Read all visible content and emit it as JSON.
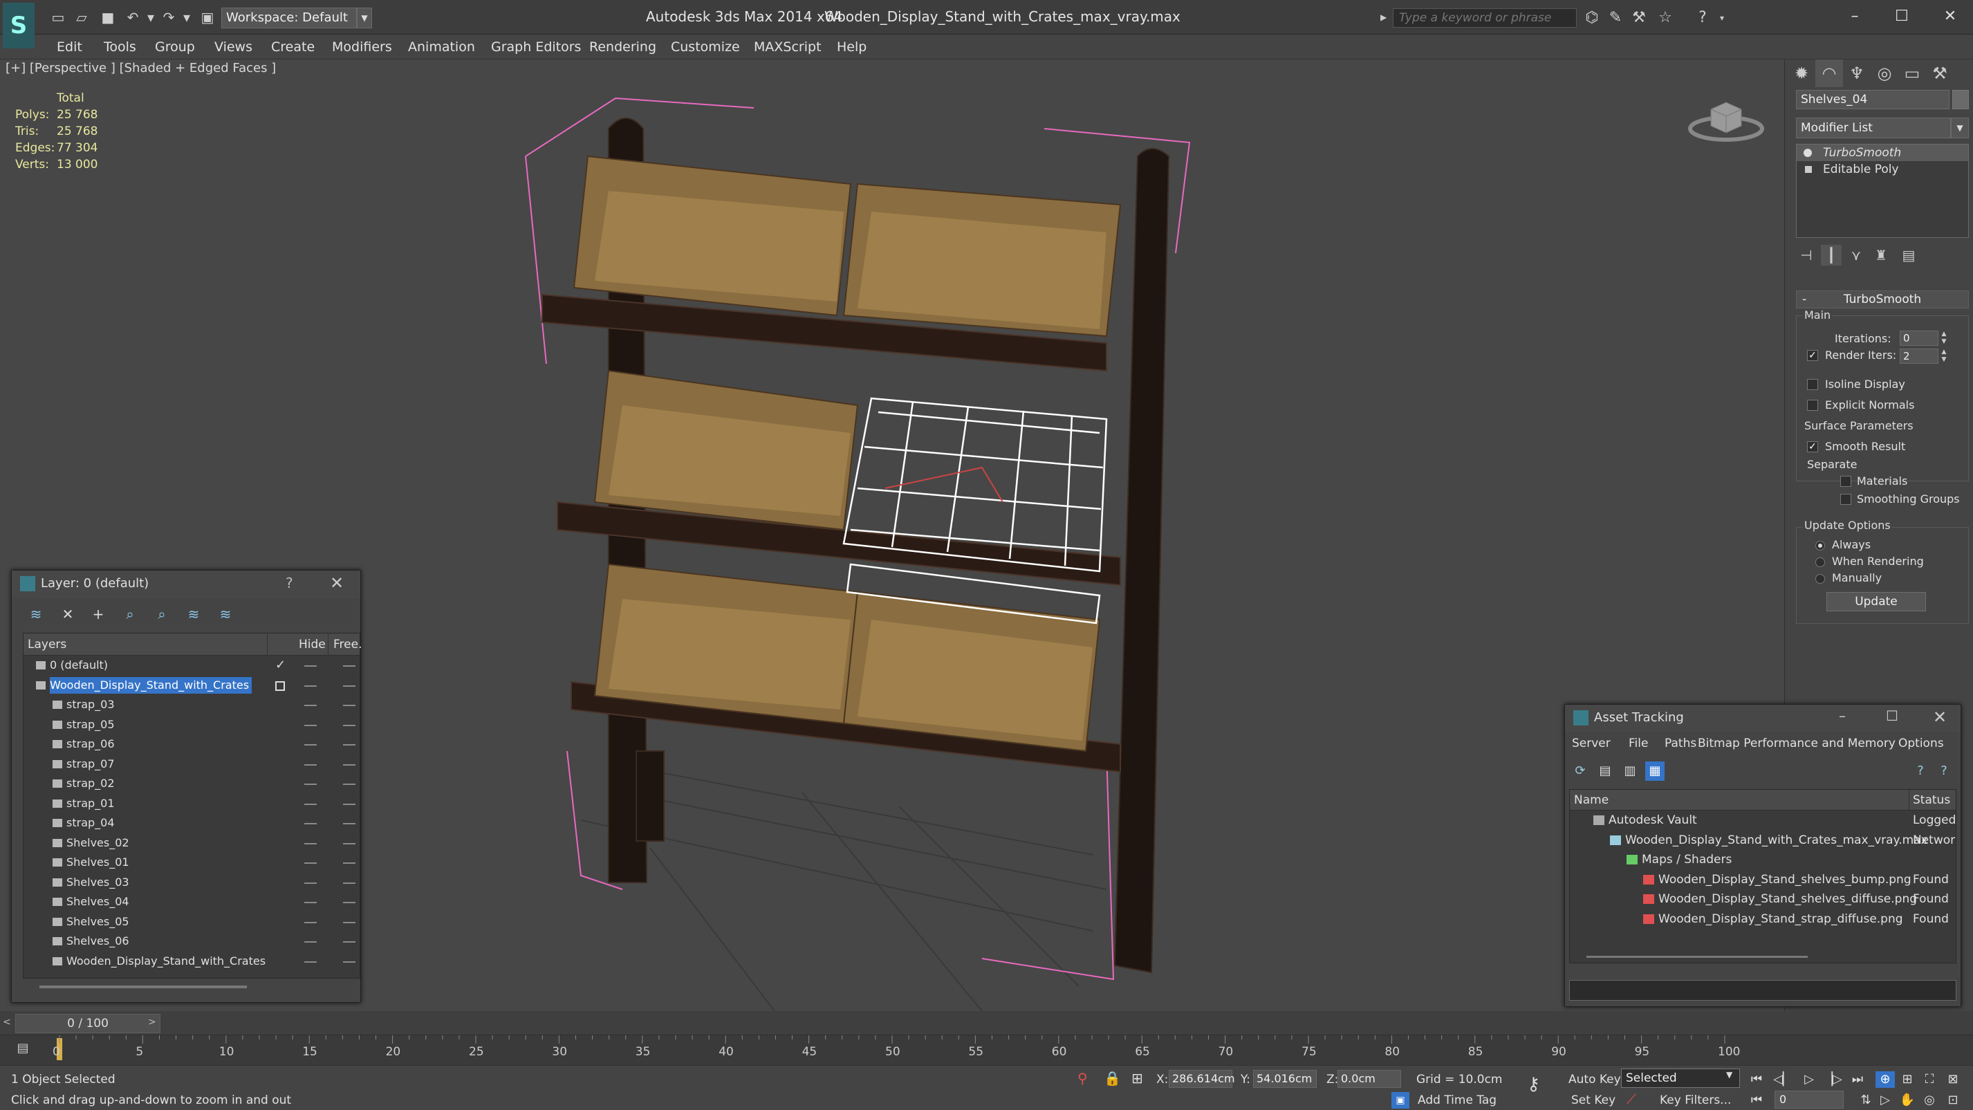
{
  "titlebar": {
    "workspace": "Workspace: Default",
    "app_title": "Autodesk 3ds Max  2014 x64",
    "file_title": "Wooden_Display_Stand_with_Crates_max_vray.max",
    "search_placeholder": "Type a keyword or phrase"
  },
  "menu": [
    "Edit",
    "Tools",
    "Group",
    "Views",
    "Create",
    "Modifiers",
    "Animation",
    "Graph Editors",
    "Rendering",
    "Customize",
    "MAXScript",
    "Help"
  ],
  "viewport": {
    "label": "[+] [Perspective ] [Shaded + Edged Faces ]",
    "stats_header": "Total",
    "stats": [
      {
        "label": "Polys:",
        "value": "25 768"
      },
      {
        "label": "Tris:",
        "value": "25 768"
      },
      {
        "label": "Edges:",
        "value": "77 304"
      },
      {
        "label": "Verts:",
        "value": "13 000"
      }
    ]
  },
  "command_panel": {
    "object_name": "Shelves_04",
    "modifier_list": "Modifier List",
    "stack": [
      "TurboSmooth",
      "Editable Poly"
    ],
    "rollout_title": "TurboSmooth",
    "main_group": "Main",
    "iterations_label": "Iterations:",
    "iterations_value": "0",
    "render_iters_label": "Render Iters:",
    "render_iters_value": "2",
    "isoline_label": "Isoline Display",
    "explicit_normals_label": "Explicit Normals",
    "surface_group": "Surface Parameters",
    "smooth_result_label": "Smooth Result",
    "separate_label": "Separate",
    "materials_label": "Materials",
    "smoothing_groups_label": "Smoothing Groups",
    "update_group": "Update Options",
    "always_label": "Always",
    "when_rendering_label": "When Rendering",
    "manually_label": "Manually",
    "update_button": "Update"
  },
  "layer_dialog": {
    "title": "Layer: 0 (default)",
    "help": "?",
    "col_layers": "Layers",
    "col_hide": "Hide",
    "col_freeze": "Free.",
    "rows": [
      {
        "name": "0 (default)",
        "level": 0,
        "selected": false,
        "checked": true
      },
      {
        "name": "Wooden_Display_Stand_with_Crates",
        "level": 0,
        "selected": true,
        "checked": false
      },
      {
        "name": "strap_03",
        "level": 1
      },
      {
        "name": "strap_05",
        "level": 1
      },
      {
        "name": "strap_06",
        "level": 1
      },
      {
        "name": "strap_07",
        "level": 1
      },
      {
        "name": "strap_02",
        "level": 1
      },
      {
        "name": "strap_01",
        "level": 1
      },
      {
        "name": "strap_04",
        "level": 1
      },
      {
        "name": "Shelves_02",
        "level": 1
      },
      {
        "name": "Shelves_01",
        "level": 1
      },
      {
        "name": "Shelves_03",
        "level": 1
      },
      {
        "name": "Shelves_04",
        "level": 1
      },
      {
        "name": "Shelves_05",
        "level": 1
      },
      {
        "name": "Shelves_06",
        "level": 1
      },
      {
        "name": "Wooden_Display_Stand_with_Crates",
        "level": 1
      }
    ]
  },
  "asset_dialog": {
    "title": "Asset Tracking",
    "menu": [
      "Server",
      "File",
      "Paths",
      "Bitmap Performance and Memory",
      "Options"
    ],
    "col_name": "Name",
    "col_status": "Status",
    "rows": [
      {
        "name": "Autodesk Vault",
        "status": "Logged",
        "level": 1,
        "icon": "vault"
      },
      {
        "name": "Wooden_Display_Stand_with_Crates_max_vray.max",
        "status": "Networ",
        "level": 2,
        "icon": "max"
      },
      {
        "name": "Maps / Shaders",
        "status": "",
        "level": 3,
        "icon": "maps"
      },
      {
        "name": "Wooden_Display_Stand_shelves_bump.png",
        "status": "Found",
        "level": 4,
        "icon": "png"
      },
      {
        "name": "Wooden_Display_Stand_shelves_diffuse.png",
        "status": "Found",
        "level": 4,
        "icon": "png"
      },
      {
        "name": "Wooden_Display_Stand_strap_diffuse.png",
        "status": "Found",
        "level": 4,
        "icon": "png"
      }
    ]
  },
  "timeline": {
    "slider": "0 / 100",
    "ticks": [
      "0",
      "5",
      "10",
      "15",
      "20",
      "25",
      "30",
      "35",
      "40",
      "45",
      "50",
      "55",
      "60",
      "65",
      "70",
      "75",
      "80",
      "85",
      "90",
      "95",
      "100"
    ]
  },
  "status": {
    "selection": "1 Object Selected",
    "prompt": "Click and drag up-and-down to zoom in and out",
    "x_label": "X:",
    "x_value": "286.614cm",
    "y_label": "Y:",
    "y_value": "54.016cm",
    "z_label": "Z:",
    "z_value": "0.0cm",
    "grid": "Grid = 10.0cm",
    "add_time_tag": "Add Time Tag",
    "auto_key": "Auto Key",
    "set_key": "Set Key",
    "selected_dropdown": "Selected",
    "key_filters": "Key Filters...",
    "frame": "0"
  }
}
